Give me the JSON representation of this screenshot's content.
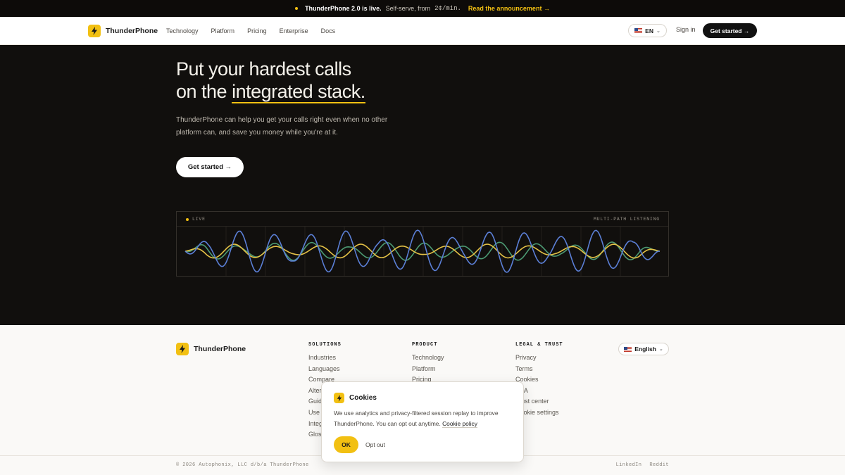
{
  "announcement": {
    "headline": "ThunderPhone 2.0 is live.",
    "text": "Self-serve, from",
    "price": "2¢/min.",
    "link": "Read the announcement →"
  },
  "nav": {
    "brand": "ThunderPhone",
    "links": [
      "Technology",
      "Platform",
      "Pricing",
      "Enterprise",
      "Docs"
    ],
    "language": "EN",
    "signin": "Sign in",
    "cta": "Get started →"
  },
  "hero": {
    "title_line1": "Put your hardest calls",
    "title_line2_prefix": "on the",
    "title_line2_highlight": "integrated stack.",
    "lead": "ThunderPhone can help you get your calls right even when no other platform can, and save you money while you're at it.",
    "cta": "Get started →"
  },
  "wave_panel": {
    "live_label": "LIVE",
    "mode_label": "MULTI-PATH LISTENING",
    "colors": {
      "blue": "#5b7fd6",
      "green": "#4c9a73",
      "yellow": "#e4c146"
    }
  },
  "footer": {
    "brand": "ThunderPhone",
    "columns": [
      {
        "heading": "SOLUTIONS",
        "items": [
          "Industries",
          "Languages",
          "Compare",
          "Alternatives",
          "Guides",
          "Use cases",
          "Integrations",
          "Glossary"
        ]
      },
      {
        "heading": "PRODUCT",
        "items": [
          "Technology",
          "Platform",
          "Pricing"
        ]
      },
      {
        "heading": "LEGAL & TRUST",
        "items": [
          "Privacy",
          "Terms",
          "Cookies",
          "DPA",
          "Trust center",
          "Cookie settings"
        ]
      }
    ],
    "language": "English",
    "copyright": "© 2026 Autophonix, LLC d/b/a ThunderPhone",
    "social": [
      "LinkedIn",
      "Reddit"
    ]
  },
  "cookie_banner": {
    "title": "Cookies",
    "body": "We use analytics and privacy-filtered session replay to improve ThunderPhone. You can opt out anytime.",
    "policy_link": "Cookie policy",
    "ok": "OK",
    "opt_out": "Opt out"
  },
  "colors": {
    "accent": "#f2c012",
    "hero_bg": "#110f0d",
    "footer_bg": "#faf9f7"
  }
}
